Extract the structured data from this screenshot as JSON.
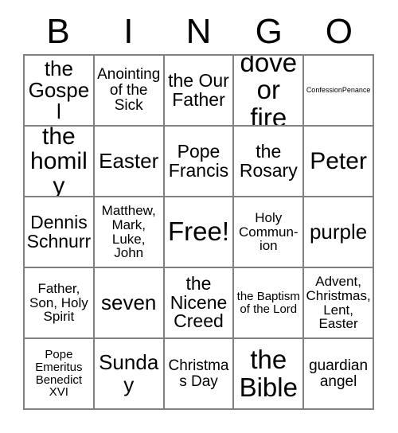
{
  "card": {
    "header_letters": [
      "B",
      "I",
      "N",
      "G",
      "O"
    ],
    "free_space_label": "Free!",
    "grid": {
      "columns": 5,
      "rows": 5,
      "border_color": "#808080",
      "background_color": "#ffffff",
      "text_color": "#000000"
    },
    "cells": [
      [
        {
          "text": "the Gospel",
          "size": "lg"
        },
        {
          "text": "Anointing of the Sick",
          "size": "sm"
        },
        {
          "text": "the Our Father",
          "size": "md"
        },
        {
          "text": "dove or fire",
          "size": "xxl"
        },
        {
          "text": "ConfessionPenance",
          "size": "tiny"
        }
      ],
      [
        {
          "text": "the homily",
          "size": "xl"
        },
        {
          "text": "Easter",
          "size": "lg"
        },
        {
          "text": "Pope Francis",
          "size": "md"
        },
        {
          "text": "the Rosary",
          "size": "md"
        },
        {
          "text": "Peter",
          "size": "xl"
        }
      ],
      [
        {
          "text": "Dennis Schnurr",
          "size": "md"
        },
        {
          "text": "Matthew, Mark, Luke, John",
          "size": "xs"
        },
        {
          "text": "Free!",
          "size": "xxl"
        },
        {
          "text": "Holy Commun-ion",
          "size": "xs"
        },
        {
          "text": "purple",
          "size": "lg"
        }
      ],
      [
        {
          "text": "Father, Son, Holy Spirit",
          "size": "xs"
        },
        {
          "text": "seven",
          "size": "lg"
        },
        {
          "text": "the Nicene Creed",
          "size": "md"
        },
        {
          "text": "the Baptism of the Lord",
          "size": "xxs"
        },
        {
          "text": "Advent, Christmas, Lent, Easter",
          "size": "xs"
        }
      ],
      [
        {
          "text": "Pope Emeritus Benedict XVI",
          "size": "xxs"
        },
        {
          "text": "Sunday",
          "size": "lg"
        },
        {
          "text": "Christmas Day",
          "size": "sm"
        },
        {
          "text": "the Bible",
          "size": "xxl"
        },
        {
          "text": "guardian angel",
          "size": "sm"
        }
      ]
    ]
  }
}
